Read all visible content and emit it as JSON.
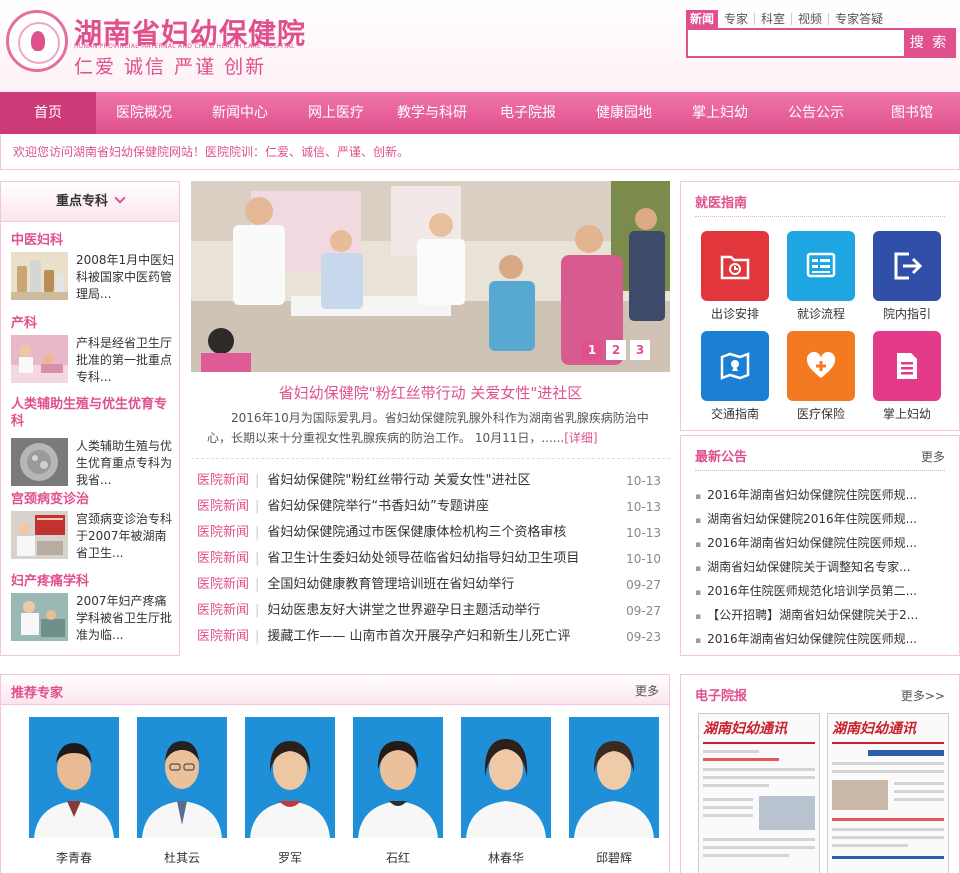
{
  "header": {
    "name": "湖南省妇幼保健院",
    "name_en": "HUNAN PROVINCIAL MATERNAL AND CHILD HEALTH CARE HOSPITAL",
    "motto": "仁爱 诚信 严谨 创新"
  },
  "search": {
    "tabs": [
      "新闻",
      "专家",
      "科室",
      "视频",
      "专家答疑"
    ],
    "placeholder": "",
    "button": "搜 索"
  },
  "nav": [
    "首页",
    "医院概况",
    "新闻中心",
    "网上医疗",
    "教学与科研",
    "电子院报",
    "健康园地",
    "掌上妇幼",
    "公告公示",
    "图书馆"
  ],
  "welcome": "欢迎您访问湖南省妇幼保健院网站！医院院训：仁爱、诚信、严谨、创新。",
  "specialties": {
    "title": "重点专科",
    "items": [
      {
        "name": "中医妇科",
        "desc": "2008年1月中医妇科被国家中医药管理局..."
      },
      {
        "name": "产科",
        "desc": "产科是经省卫生厅批准的第一批重点专科..."
      },
      {
        "name": "人类辅助生殖与优生优育专科",
        "desc": "人类辅助生殖与优生优育重点专科为我省..."
      },
      {
        "name": "宫颈病变诊治",
        "desc": "宫颈病变诊治专科于2007年被湖南省卫生..."
      },
      {
        "name": "妇产疼痛学科",
        "desc": "2007年妇产疼痛学科被省卫生厅批准为临..."
      }
    ]
  },
  "slider": {
    "pages": [
      "1",
      "2",
      "3"
    ]
  },
  "headline": {
    "title": "省妇幼保健院\"粉红丝带行动 关爱女性\"进社区",
    "summary": "2016年10月为国际爱乳月。省妇幼保健院乳腺外科作为湖南省乳腺疾病防治中心，长期以来十分重视女性乳腺疾病的防治工作。 10月11日，......",
    "more": "[详细]"
  },
  "news": [
    {
      "cat": "医院新闻",
      "title": "省妇幼保健院\"粉红丝带行动 关爱女性\"进社区",
      "date": "10-13"
    },
    {
      "cat": "医院新闻",
      "title": "省妇幼保健院举行“书香妇幼”专题讲座",
      "date": "10-13"
    },
    {
      "cat": "医院新闻",
      "title": "省妇幼保健院通过市医保健康体检机构三个资格审核",
      "date": "10-13"
    },
    {
      "cat": "医院新闻",
      "title": "省卫生计生委妇幼处领导莅临省妇幼指导妇幼卫生项目",
      "date": "10-10"
    },
    {
      "cat": "医院新闻",
      "title": "全国妇幼健康教育管理培训班在省妇幼举行",
      "date": "09-27"
    },
    {
      "cat": "医院新闻",
      "title": "妇幼医患友好大讲堂之世界避孕日主题活动举行",
      "date": "09-27"
    },
    {
      "cat": "医院新闻",
      "title": "援藏工作—— 山南市首次开展孕产妇和新生儿死亡评",
      "date": "09-23"
    }
  ],
  "guide": {
    "title": "就医指南",
    "items": [
      {
        "label": "出诊安排",
        "color": "#e0363c"
      },
      {
        "label": "就诊流程",
        "color": "#1ea6e2"
      },
      {
        "label": "院内指引",
        "color": "#2f4fa8"
      },
      {
        "label": "交通指南",
        "color": "#1b7fd4"
      },
      {
        "label": "医疗保险",
        "color": "#f47a21"
      },
      {
        "label": "掌上妇幼",
        "color": "#e33a8a"
      }
    ]
  },
  "notices": {
    "title": "最新公告",
    "more": "更多",
    "items": [
      "2016年湖南省妇幼保健院住院医师规...",
      "湖南省妇幼保健院2016年住院医师规...",
      "2016年湖南省妇幼保健院住院医师规...",
      "湖南省妇幼保健院关于调整知名专家...",
      "2016年住院医师规范化培训学员第二...",
      "【公开招聘】湖南省妇幼保健院关于2...",
      "2016年湖南省妇幼保健院住院医师规..."
    ]
  },
  "experts": {
    "title": "推荐专家",
    "more": "更多",
    "items": [
      "李青春",
      "杜其云",
      "罗军",
      "石红",
      "林春华",
      "邱碧辉"
    ]
  },
  "epaper": {
    "title": "电子院报",
    "more": "更多>>",
    "masthead": "湖南妇幼通讯"
  }
}
